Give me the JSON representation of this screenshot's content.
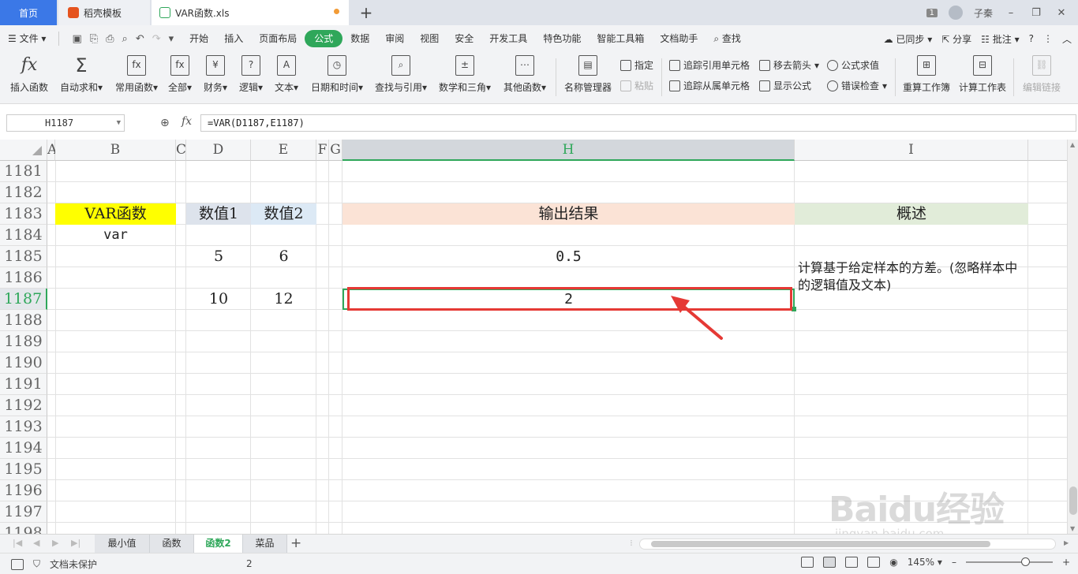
{
  "tabs": {
    "home": "首页",
    "docer": "稻壳模板",
    "file": "VAR函数.xls",
    "add": "+"
  },
  "title_right": {
    "badge": "1",
    "user": "子秦",
    "minimize": "–",
    "restore": "❐",
    "close": "✕"
  },
  "menu": {
    "file": "文件",
    "items": [
      "开始",
      "插入",
      "页面布局",
      "公式",
      "数据",
      "审阅",
      "视图",
      "安全",
      "开发工具",
      "特色功能",
      "智能工具箱",
      "文档助手"
    ],
    "active": "公式",
    "search": "查找",
    "synced": "已同步",
    "share": "分享",
    "comment": "批注"
  },
  "ribbon": {
    "insert_fn": "插入函数",
    "autosum": "自动求和",
    "common_fn": "常用函数",
    "all": "全部",
    "finance": "财务",
    "logic": "逻辑",
    "text": "文本",
    "datetime": "日期和时间",
    "lookup": "查找与引用",
    "math": "数学和三角",
    "other_fn": "其他函数",
    "name_mgr": "名称管理器",
    "define": "指定",
    "paste": "粘贴",
    "trace_prec": "追踪引用单元格",
    "trace_dep": "追踪从属单元格",
    "remove_arrows": "移去箭头",
    "show_formula": "显示公式",
    "eval_formula": "公式求值",
    "error_check": "错误检查",
    "recalc_book": "重算工作簿",
    "calc_sheet": "计算工作表",
    "edit_links": "编辑链接"
  },
  "formula_bar": {
    "name_box": "H1187",
    "fx": "fx",
    "formula": "=VAR(D1187,E1187)"
  },
  "columns": [
    "A",
    "B",
    "C",
    "D",
    "E",
    "F",
    "G",
    "H",
    "I"
  ],
  "selected_column": "H",
  "rows": [
    "1181",
    "1182",
    "1183",
    "1184",
    "1185",
    "1186",
    "1187",
    "1188",
    "1189",
    "1190",
    "1191",
    "1192",
    "1193",
    "1194",
    "1195",
    "1196",
    "1197",
    "1198"
  ],
  "selected_row": "1187",
  "cells": {
    "B1183": "VAR函数",
    "D1183": "数值1",
    "E1183": "数值2",
    "H1183": "输出结果",
    "I1183": "概述",
    "B1184": "var",
    "D1185": "5",
    "E1185": "6",
    "H1185": "0.5",
    "I1185": "计算基于给定样本的方差。(忽略样本中的逻辑值及文本)",
    "D1187": "10",
    "E1187": "12",
    "H1187": "2"
  },
  "sheets": [
    "最小值",
    "函数",
    "函数2",
    "菜品"
  ],
  "active_sheet": "函数2",
  "status": {
    "protect": "文档未保护",
    "count": "2",
    "zoom": "145%"
  },
  "watermark": {
    "brand": "Baidu经验",
    "url": "jingyan.baidu.com"
  },
  "colors": {
    "accent_green": "#2fa75a",
    "tab_blue": "#3b78e7",
    "highlight_red": "#e53935",
    "yellow_fill": "#ffff00"
  }
}
